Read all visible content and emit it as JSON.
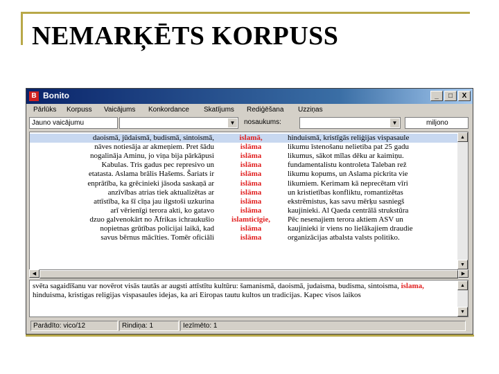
{
  "slide": {
    "title": "NEMARĶĒTS KORPUSS",
    "accent_color": "#b8a848"
  },
  "window": {
    "icon_text": "B",
    "title": "Bonito",
    "controls": {
      "minimize": "_",
      "maximize": "□",
      "close": "X"
    }
  },
  "menu": [
    "Pārlūks",
    "Korpuss",
    "Vaicājums",
    "Konkordance",
    "Skatījums",
    "Rediģēšana",
    "Uzziņas"
  ],
  "toolbar": {
    "query_history": "Jauno vaicājumu",
    "query_input": "",
    "found_label": "nosaukums:",
    "found_value": "",
    "count_value": "miljono"
  },
  "concordance": [
    {
      "left": "daoismā, jūdaismā, budismā, sintoismā,",
      "kw": "islamā,",
      "right": "hinduismā, kristīgās reliģijas vispasaule"
    },
    {
      "left": "nāves notiesāja ar akmeņiem. Pret šādu",
      "kw": "islāma",
      "right": "likumu īstenošanu nelietiba pat 25 gadu"
    },
    {
      "left": "nogalināja Aminu, jo viņa bija pārkāpusi",
      "kw": "islāma",
      "right": "likumus, sākot mīlas dēku ar kaimiņu."
    },
    {
      "left": "Kabulas. Tris gadus pec represivo un",
      "kw": "islāma",
      "right": "fundamentalistu kontroleta Taleban rež"
    },
    {
      "left": "etatasta. Aslama brālis Hašems. Šariats ir",
      "kw": "islāma",
      "right": "likumu kopums, un Aslama pickrita vie"
    },
    {
      "left": "enprātība, ka grēcinieki jāsoda saskaņā ar",
      "kw": "islāma",
      "right": "likumiem. Kerimam kā neprecētam vīri"
    },
    {
      "left": "anzīvības atrias tiek aktualizētas ar",
      "kw": "islāma",
      "right": "un kristietības konfliktu, romantizētas"
    },
    {
      "left": "attīstība, ka šī cīņa jau ilgstoši uzkurina",
      "kw": "islāma",
      "right": "ekstrēmistus, kas savu mērķu sasniegš"
    },
    {
      "left": "arī vērienīgi terora akti, ko gatavo",
      "kw": "islāma",
      "right": "kaujinieki. Al Qaeda centrālā strukstūra"
    },
    {
      "left": "dzuo galvenokārt no Āfrikas ichraukušio",
      "kw": "islamticīgie,",
      "right": "Pēc nesenajiem terora aktiem ASV un"
    },
    {
      "left": "nopietnas grūtības policijai laikā, kad",
      "kw": "islāma",
      "right": "kaujinieki ir viens no lielākajiem draudie"
    },
    {
      "left": "savus bērnus mācīties. Tomēr oficiāli",
      "kw": "islāma",
      "right": "organizācijas atbalsta valsts politiko."
    }
  ],
  "context": {
    "before": "svēta sagaidīšanu var novērot visās tautās ar augsti attīstītu kultūru: šamanismā, daoismā, judaisma, budisma, sintoisma,",
    "keyword": "islama,",
    "after": "hinduisma, kristigas religijas vispasaules idejas, ka ari Eiropas tautu kultos un tradicijas. Kapec visos laikos"
  },
  "status": {
    "shown": "Parādīto: vico/12",
    "line": "Rindiņa: 1",
    "position": "Iezīmēto: 1"
  }
}
